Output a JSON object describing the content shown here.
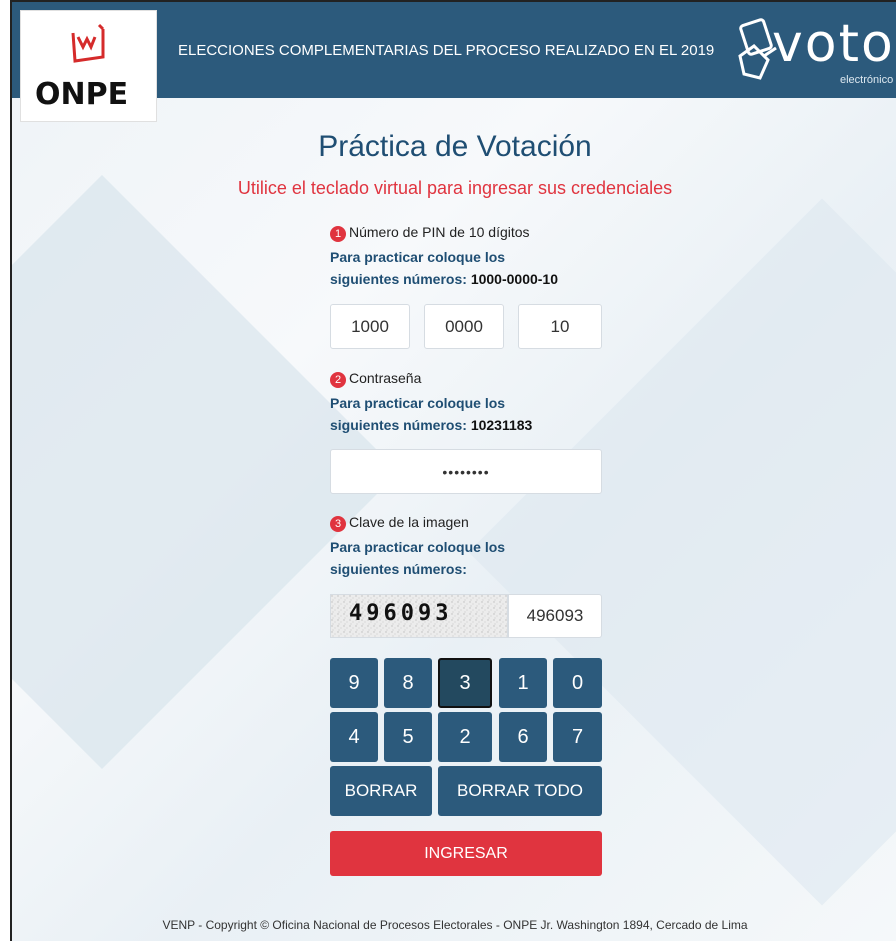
{
  "header": {
    "logo_text": "ONPE",
    "title": "ELECCIONES COMPLEMENTARIAS DEL PROCESO REALIZADO EN EL 2019",
    "voto_logo_word": "voto",
    "voto_logo_sub": "electrónico",
    "colors": {
      "bar": "#2c5a7c",
      "accent": "#e0343f"
    }
  },
  "main": {
    "title": "Práctica de Votación",
    "subtitle": "Utilice el teclado virtual para ingresar sus credenciales",
    "pin": {
      "number": "1",
      "label": "Número de PIN de 10 dígitos",
      "help_line1": "Para practicar coloque los",
      "help_line2": "siguientes números:",
      "help_value": "1000-0000-10",
      "fields": [
        "1000",
        "0000",
        "10"
      ]
    },
    "password": {
      "number": "2",
      "label": "Contraseña",
      "help_line1": "Para practicar coloque los",
      "help_line2": "siguientes números:",
      "help_value": "10231183",
      "value": "••••••••"
    },
    "captcha": {
      "number": "3",
      "label": "Clave de la imagen",
      "help_line1": "Para practicar coloque los",
      "help_line2": "siguientes números:",
      "image_text": "496093",
      "value": "496093"
    },
    "keypad": {
      "row1": [
        "9",
        "8",
        "3",
        "1",
        "0"
      ],
      "row2": [
        "4",
        "5",
        "2",
        "6",
        "7"
      ],
      "clear_label": "BORRAR",
      "clear_all_label": "BORRAR TODO"
    },
    "submit_label": "INGRESAR"
  },
  "footer": {
    "text": "VENP - Copyright © Oficina Nacional de Procesos Electorales - ONPE Jr. Washington 1894, Cercado de Lima"
  }
}
